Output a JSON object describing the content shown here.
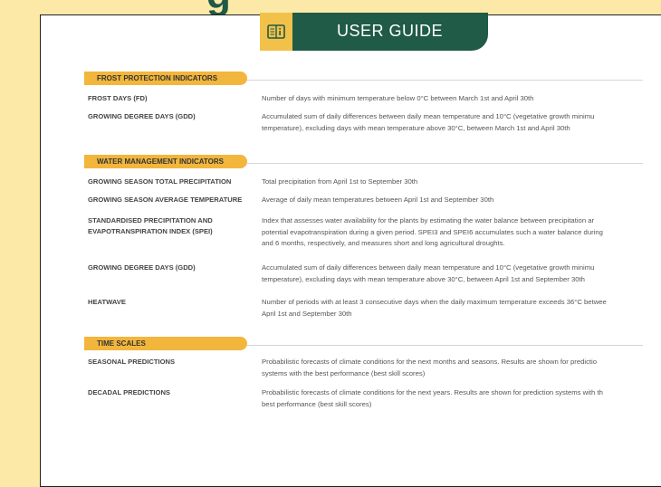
{
  "header": {
    "partial_heading": "g",
    "title": "USER GUIDE",
    "icon": "book-info-icon"
  },
  "sections": [
    {
      "label": "FROST PROTECTION INDICATORS",
      "rows": [
        {
          "term": [
            "FROST DAYS (FD)"
          ],
          "definition": [
            "Number of days with minimum temperature below 0°C between March 1st and April 30th"
          ]
        },
        {
          "term": [
            "GROWING DEGREE DAYS (GDD)"
          ],
          "definition": [
            "Accumulated sum of daily differences between daily mean temperature and 10°C (vegetative growth minimu",
            "temperature), excluding days with mean temperature above 30°C, between March 1st and April 30th"
          ]
        }
      ]
    },
    {
      "label": "WATER MANAGEMENT INDICATORS",
      "rows": [
        {
          "term": [
            "GROWING SEASON TOTAL PRECIPITATION"
          ],
          "definition": [
            "Total precipitation from April 1st to September 30th"
          ]
        },
        {
          "term": [
            "GROWING SEASON AVERAGE TEMPERATURE"
          ],
          "definition": [
            "Average of daily mean temperatures between April 1st and September 30th"
          ]
        },
        {
          "term": [
            "STANDARDISED PRECIPITATION AND",
            "EVAPOTRANSPIRATION INDEX (SPEI)"
          ],
          "definition": [
            "Index that assesses water availability for the plants by estimating the water balance between precipitation ar",
            "potential evapotranspiration during a given period. SPEI3 and SPEI6 accumulates such a water balance during",
            "and 6 months, respectively, and measures short and long agricultural droughts."
          ]
        },
        {
          "term": [
            "GROWING DEGREE DAYS (GDD)"
          ],
          "definition": [
            "Accumulated sum of daily differences between daily mean temperature and 10°C (vegetative growth minimu",
            "temperature), excluding days with mean temperature above 30°C, between April 1st and September 30th"
          ]
        },
        {
          "term": [
            "HEATWAVE"
          ],
          "definition": [
            "Number of periods with at least 3 consecutive days when the daily maximum temperature exceeds 36°C betwee",
            "April 1st and September 30th"
          ]
        }
      ]
    },
    {
      "label": "TIME SCALES",
      "rows": [
        {
          "term": [
            "SEASONAL PREDICTIONS"
          ],
          "definition": [
            "Probabilistic forecasts of climate conditions for the next months and seasons. Results are shown for predictio",
            "systems with the best performance (best skill scores)"
          ]
        },
        {
          "term": [
            "DECADAL PREDICTIONS"
          ],
          "definition": [
            "Probabilistic forecasts of climate conditions for the next years. Results are shown for prediction systems with th",
            "best performance (best skill scores)"
          ]
        }
      ]
    }
  ],
  "colors": {
    "background": "#fce9a8",
    "banner": "#1f5b46",
    "accent": "#f2b63c"
  }
}
